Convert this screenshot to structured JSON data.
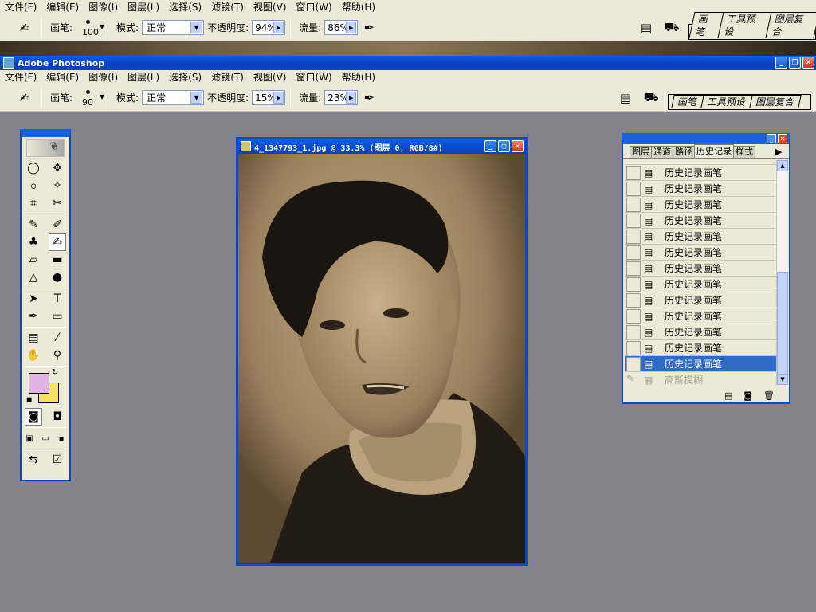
{
  "top_menu": {
    "items": [
      "文件(F)",
      "编辑(E)",
      "图像(I)",
      "图层(L)",
      "选择(S)",
      "滤镜(T)",
      "视图(V)",
      "窗口(W)",
      "帮助(H)"
    ]
  },
  "top_options": {
    "brush_label": "画笔:",
    "brush_size": "100",
    "mode_label": "模式:",
    "mode_value": "正常",
    "opacity_label": "不透明度:",
    "opacity_value": "94%",
    "flow_label": "流量:",
    "flow_value": "86%"
  },
  "palette_well": {
    "tabs": [
      "画笔",
      "工具预设",
      "图层复合"
    ]
  },
  "app_title": "Adobe Photoshop",
  "menu": {
    "items": [
      "文件(F)",
      "编辑(E)",
      "图像(I)",
      "图层(L)",
      "选择(S)",
      "滤镜(T)",
      "视图(V)",
      "窗口(W)",
      "帮助(H)"
    ]
  },
  "options": {
    "brush_label": "画笔:",
    "brush_size": "90",
    "mode_label": "模式:",
    "mode_value": "正常",
    "opacity_label": "不透明度:",
    "opacity_value": "15%",
    "flow_label": "流量:",
    "flow_value": "23%"
  },
  "tools": {
    "rows": [
      [
        "marquee-tool",
        "move-tool"
      ],
      [
        "lasso-tool",
        "magic-wand-tool"
      ],
      [
        "crop-tool",
        "slice-tool"
      ],
      [
        "healing-brush-tool",
        "brush-tool"
      ],
      [
        "clone-stamp-tool",
        "history-brush-tool"
      ],
      [
        "eraser-tool",
        "gradient-tool"
      ],
      [
        "blur-tool",
        "dodge-tool"
      ],
      [
        "path-select-tool",
        "type-tool"
      ],
      [
        "pen-tool",
        "shape-tool"
      ],
      [
        "notes-tool",
        "eyedropper-tool"
      ],
      [
        "hand-tool",
        "zoom-tool"
      ]
    ],
    "icons": {
      "marquee-tool": "◯",
      "move-tool": "✥",
      "lasso-tool": "ဝ",
      "magic-wand-tool": "✧",
      "crop-tool": "⌗",
      "slice-tool": "✂",
      "healing-brush-tool": "✎",
      "brush-tool": "✐",
      "clone-stamp-tool": "♣",
      "history-brush-tool": "✍",
      "eraser-tool": "▱",
      "gradient-tool": "▬",
      "blur-tool": "△",
      "dodge-tool": "●",
      "path-select-tool": "➤",
      "type-tool": "T",
      "pen-tool": "✒",
      "shape-tool": "▭",
      "notes-tool": "▤",
      "eyedropper-tool": "⁄",
      "hand-tool": "✋",
      "zoom-tool": "⚲"
    },
    "active": "history-brush-tool",
    "fg_color": "#e2b3e4",
    "bg_color": "#f7e164"
  },
  "document": {
    "title": "4_1347793_1.jpg @ 33.3% (图层 0, RGB/8#)"
  },
  "history_panel": {
    "tabs": [
      "图层",
      "通道",
      "路径",
      "历史记录",
      "样式"
    ],
    "active_tab": "历史记录",
    "items": [
      "历史记录画笔",
      "历史记录画笔",
      "历史记录画笔",
      "历史记录画笔",
      "历史记录画笔",
      "历史记录画笔",
      "历史记录画笔",
      "历史记录画笔",
      "历史记录画笔",
      "历史记录画笔",
      "历史记录画笔",
      "历史记录画笔",
      "历史记录画笔"
    ],
    "selected_index": 12,
    "dimmed_item": "高斯模糊"
  },
  "colors": {
    "accent": "#0b48cb",
    "selection": "#316ac5",
    "workspace": "#84838b"
  }
}
